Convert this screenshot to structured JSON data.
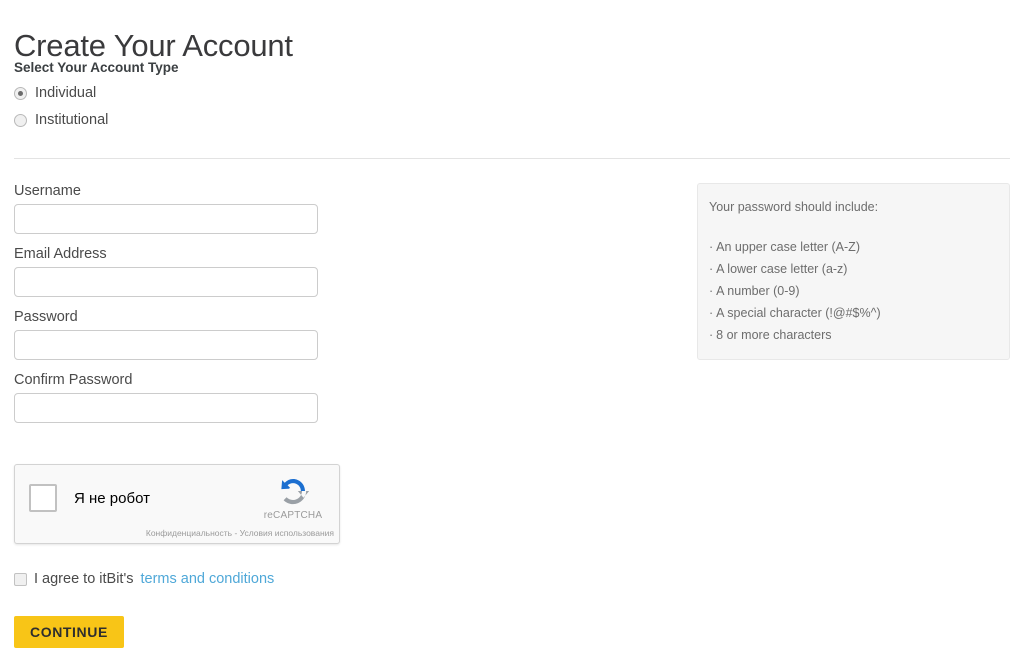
{
  "page": {
    "title": "Create Your Account"
  },
  "account_type": {
    "heading": "Select Your Account Type",
    "options": [
      {
        "label": "Individual",
        "selected": true
      },
      {
        "label": "Institutional",
        "selected": false
      }
    ]
  },
  "form": {
    "fields": [
      {
        "label": "Username",
        "value": "",
        "placeholder": "",
        "type": "text"
      },
      {
        "label": "Email Address",
        "value": "",
        "placeholder": "",
        "type": "text"
      },
      {
        "label": "Password",
        "value": "",
        "placeholder": "",
        "type": "password"
      },
      {
        "label": "Confirm Password",
        "value": "",
        "placeholder": "",
        "type": "password"
      }
    ]
  },
  "password_hints": {
    "title": "Your password should include:",
    "bullet": "·",
    "items": [
      "An upper case letter (A-Z)",
      "A lower case letter (a-z)",
      "A number (0-9)",
      "A special character (!@#$%^)",
      "8 or more characters"
    ]
  },
  "recaptcha": {
    "checkbox_label": "Я не робот",
    "brand": "reCAPTCHA",
    "footer": "Конфиденциальность - Условия использования",
    "checked": false,
    "logo_icon": "recaptcha-icon"
  },
  "terms": {
    "text": "I agree to itBit's",
    "link_label": "terms and conditions",
    "checked": false
  },
  "actions": {
    "continue_label": "CONTINUE"
  },
  "colors": {
    "accent_button": "#f8c517",
    "link": "#4fa8d8",
    "panel_bg": "#f6f6f6",
    "text": "#4a4a4a",
    "recaptcha_blue": "#1c6fd0",
    "recaptcha_gray": "#9aa0a6"
  }
}
